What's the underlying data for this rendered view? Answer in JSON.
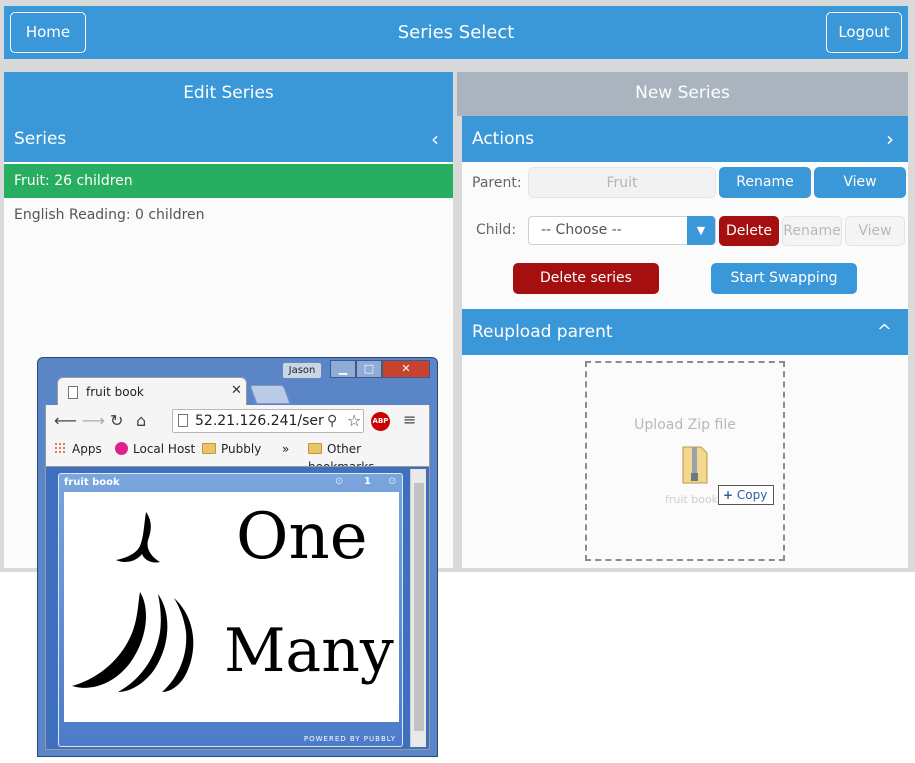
{
  "header": {
    "title": "Series Select",
    "home_label": "Home",
    "logout_label": "Logout"
  },
  "tabs": [
    {
      "label": "Edit Series"
    },
    {
      "label": "New Series"
    }
  ],
  "series_panel": {
    "title": "Series",
    "chevron": "‹",
    "items": [
      {
        "label": "Fruit: 26 children"
      },
      {
        "label": "English Reading: 0 children"
      }
    ]
  },
  "actions_panel": {
    "title": "Actions",
    "chevron": "›",
    "parent_label": "Parent:",
    "parent_value": "Fruit",
    "rename_label": "Rename",
    "view_label": "View",
    "child_label": "Child:",
    "child_select": "-- Choose --",
    "delete_label": "Delete",
    "child_rename_label": "Rename",
    "child_view_label": "View",
    "delete_series_label": "Delete series",
    "start_swapping_label": "Start Swapping"
  },
  "reupload_panel": {
    "title": "Reupload parent",
    "chevron": "^",
    "dropzone_text": "Upload Zip file",
    "drag_file_name": "fruit book.zip",
    "copy_label": "Copy"
  },
  "browser": {
    "user_label": "Jason",
    "tab_title": "fruit book",
    "url": "52.21.126.241/ser",
    "bookmarks": [
      "Apps",
      "Local Host",
      "Pubbly",
      "»",
      "Other bookmarks"
    ],
    "book": {
      "title": "fruit book",
      "page_number": "1",
      "word_one": "One",
      "word_many": "Many",
      "brand": "POWERED BY PUBBLY"
    }
  },
  "colors": {
    "primary": "#3a97d8",
    "success": "#27ae60",
    "danger": "#a50f0f",
    "tab_inactive": "#a9b4bf"
  }
}
